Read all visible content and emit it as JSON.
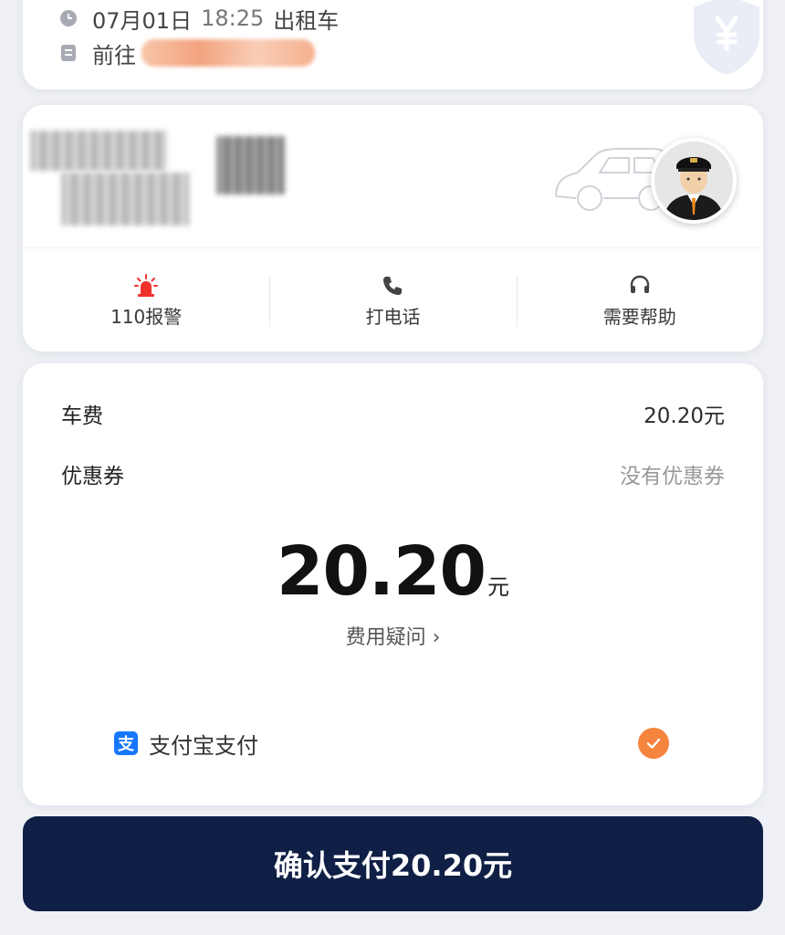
{
  "trip": {
    "time": "07月01日",
    "time_blurred": "18:25",
    "ride_type": "出租车",
    "destination_prefix": "前往"
  },
  "actions": {
    "police": "110报警",
    "call": "打电话",
    "help": "需要帮助"
  },
  "fare": {
    "fee_label": "车费",
    "fee_value": "20.20元",
    "coupon_label": "优惠券",
    "coupon_value": "没有优惠券",
    "total_amount": "20.20",
    "total_unit": "元",
    "question_link": "费用疑问 ›"
  },
  "payment": {
    "icon_char": "支",
    "method": "支付宝支付",
    "selected": true
  },
  "confirm": {
    "label": "确认支付20.20元"
  },
  "colors": {
    "button_bg": "#0f1f45",
    "check_orange": "#f5843e",
    "alarm_red": "#f0322d",
    "alipay_blue": "#1677ff"
  }
}
